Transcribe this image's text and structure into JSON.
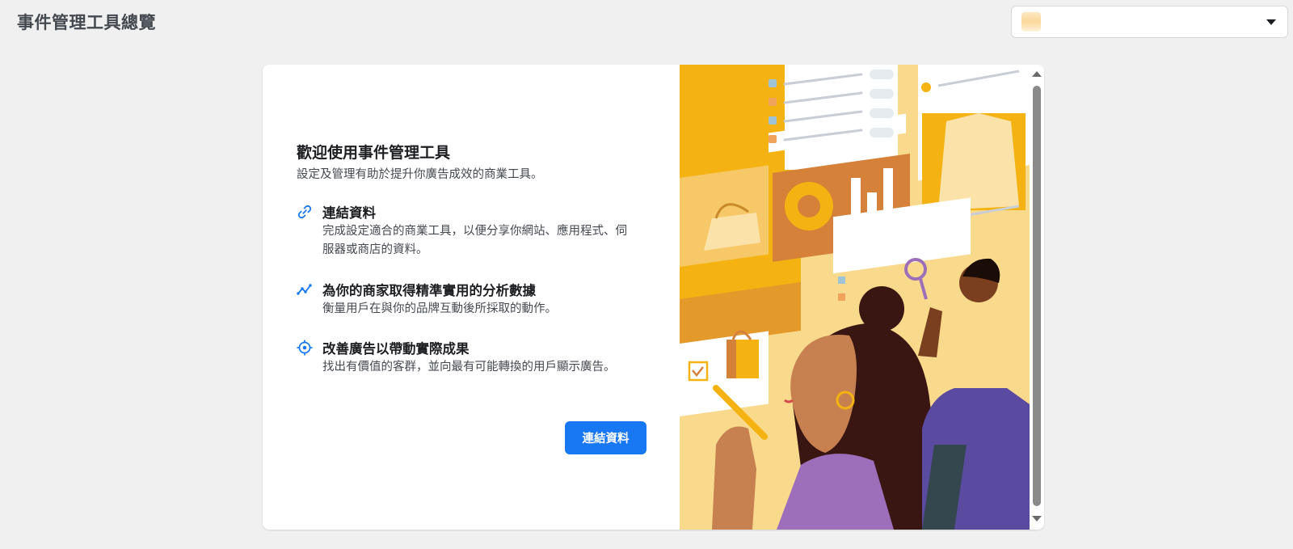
{
  "header": {
    "title": "事件管理工具總覽",
    "account_selector": {
      "selected_value": "",
      "icon": "chevron-down-icon"
    }
  },
  "welcome": {
    "title": "歡迎使用事件管理工具",
    "subtitle": "設定及管理有助於提升你廣告成效的商業工具。",
    "features": [
      {
        "icon": "link-icon",
        "title": "連結資料",
        "description": "完成設定適合的商業工具，以便分享你網站、應用程式、伺服器或商店的資料。"
      },
      {
        "icon": "trend-line-icon",
        "title": "為你的商家取得精準實用的分析數據",
        "description": "衡量用戶在與你的品牌互動後所採取的動作。"
      },
      {
        "icon": "target-icon",
        "title": "改善廣告以帶動實際成果",
        "description": "找出有價值的客群，並向最有可能轉換的用戶顯示廣告。"
      }
    ],
    "connect_button_label": "連結資料"
  },
  "colors": {
    "primary_button": "#1877f2",
    "page_background": "#f0f0f0",
    "illustration_background": "#f9d98b",
    "illustration_accent": "#f4b312"
  }
}
